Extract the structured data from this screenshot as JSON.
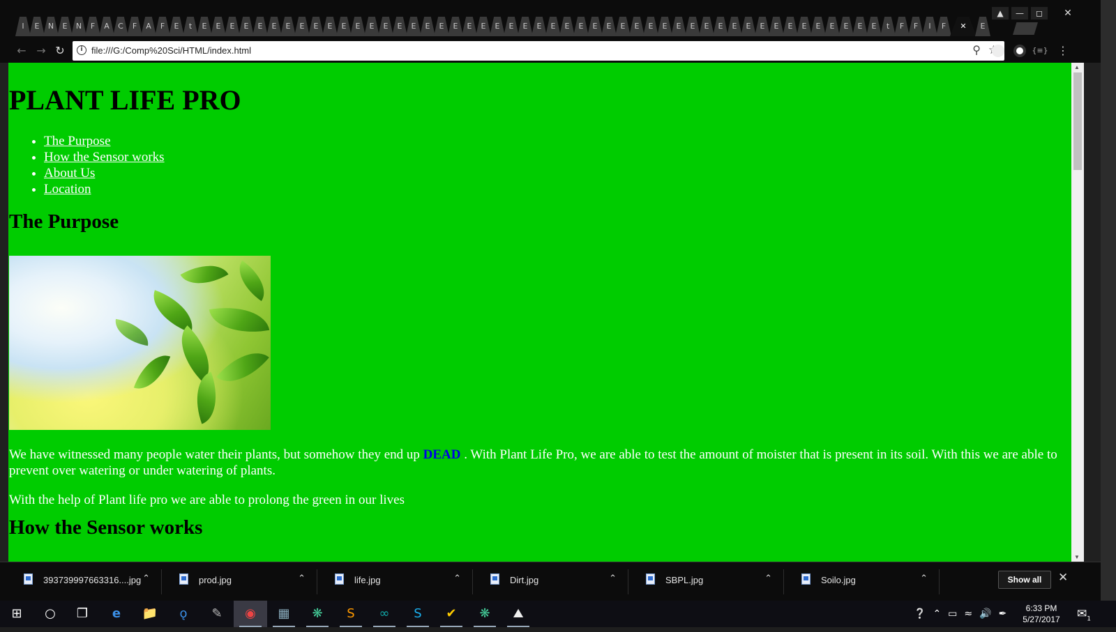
{
  "browser": {
    "tab_letters": [
      "I",
      "E",
      "N",
      "E",
      "N",
      "F",
      "A",
      "C",
      "F",
      "A",
      "F",
      "E",
      "t",
      "E",
      "E",
      "E",
      "E",
      "E",
      "E",
      "E",
      "E",
      "E",
      "E",
      "E",
      "E",
      "E",
      "E",
      "E",
      "E",
      "E",
      "E",
      "E",
      "E",
      "E",
      "E",
      "E",
      "E",
      "E",
      "E",
      "E",
      "E",
      "E",
      "E",
      "E",
      "E",
      "E",
      "E",
      "E",
      "E",
      "E",
      "E",
      "E",
      "E",
      "E",
      "E",
      "E",
      "E",
      "E",
      "E",
      "E",
      "E",
      "E",
      "t",
      "F",
      "F",
      "I",
      "F"
    ],
    "active_tab_close": "✕",
    "active_tab_letter": "E",
    "url": "file:///G:/Comp%20Sci/HTML/index.html"
  },
  "page": {
    "title": "PLANT LIFE PRO",
    "nav": [
      "The Purpose",
      "How the Sensor works",
      "About Us",
      "Location"
    ],
    "section1_heading": "The Purpose",
    "paragraph1_before": "We have witnessed many people water their plants, but somehow they end up ",
    "paragraph1_dead": "DEAD",
    "paragraph1_after": " . With Plant Life Pro, we are able to test the amount of moister that is present in its soil. With this we are able to prevent over watering or under watering of plants.",
    "paragraph2": "With the help of Plant life pro we are able to prolong the green in our lives",
    "section2_heading": "How the Sensor works"
  },
  "downloads": {
    "items": [
      "393739997663316....jpg",
      "prod.jpg",
      "life.jpg",
      "Dirt.jpg",
      "SBPL.jpg",
      "Soilo.jpg"
    ],
    "show_all": "Show all"
  },
  "taskbar": {
    "time": "6:33 PM",
    "date": "5/27/2017",
    "notification_count": "1"
  }
}
